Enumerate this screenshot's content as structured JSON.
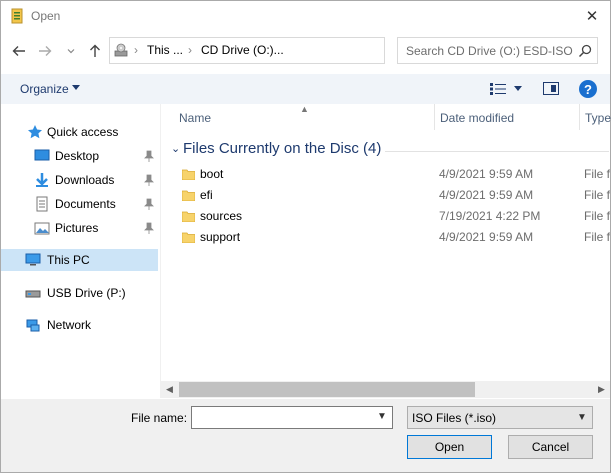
{
  "window": {
    "title": "Open",
    "close_glyph": "✕"
  },
  "nav": {
    "back_icon": "back-arrow-icon",
    "forward_icon": "forward-arrow-icon",
    "recent_icon": "chevron-down-icon",
    "up_icon": "up-arrow-icon"
  },
  "address": {
    "crumbs": [
      "This ...",
      "CD Drive (O:)..."
    ],
    "separator": "›",
    "dropdown_glyph": "⌄",
    "refresh_glyph": "↻"
  },
  "search": {
    "placeholder": "Search CD Drive (O:) ESD-ISO"
  },
  "toolbar": {
    "organize_label": "Organize",
    "help_glyph": "?"
  },
  "sidebar": {
    "items": [
      {
        "label": "Quick access",
        "icon": "star-icon"
      },
      {
        "label": "Desktop",
        "icon": "desktop-icon",
        "pinned": true
      },
      {
        "label": "Downloads",
        "icon": "download-icon",
        "pinned": true
      },
      {
        "label": "Documents",
        "icon": "document-icon",
        "pinned": true
      },
      {
        "label": "Pictures",
        "icon": "pictures-icon",
        "pinned": true
      },
      {
        "label": "This PC",
        "icon": "computer-icon",
        "selected": true
      },
      {
        "label": "USB Drive (P:)",
        "icon": "usb-drive-icon"
      },
      {
        "label": "Network",
        "icon": "network-icon"
      }
    ]
  },
  "columns": {
    "name": "Name",
    "date": "Date modified",
    "type": "Type"
  },
  "group": {
    "title": "Files Currently on the Disc (4)",
    "caret": "⌄"
  },
  "files": [
    {
      "name": "boot",
      "date": "4/9/2021 9:59 AM",
      "type": "File folder"
    },
    {
      "name": "efi",
      "date": "4/9/2021 9:59 AM",
      "type": "File folder"
    },
    {
      "name": "sources",
      "date": "7/19/2021 4:22 PM",
      "type": "File folder"
    },
    {
      "name": "support",
      "date": "4/9/2021 9:59 AM",
      "type": "File folder"
    }
  ],
  "bottom": {
    "filename_label": "File name:",
    "filename_value": "",
    "filter_value": "ISO Files (*.iso)",
    "open_label": "Open",
    "cancel_label": "Cancel"
  },
  "colors": {
    "accent": "#1e3a6e",
    "selection": "#cce4f7",
    "folder": "#f7d36b"
  }
}
